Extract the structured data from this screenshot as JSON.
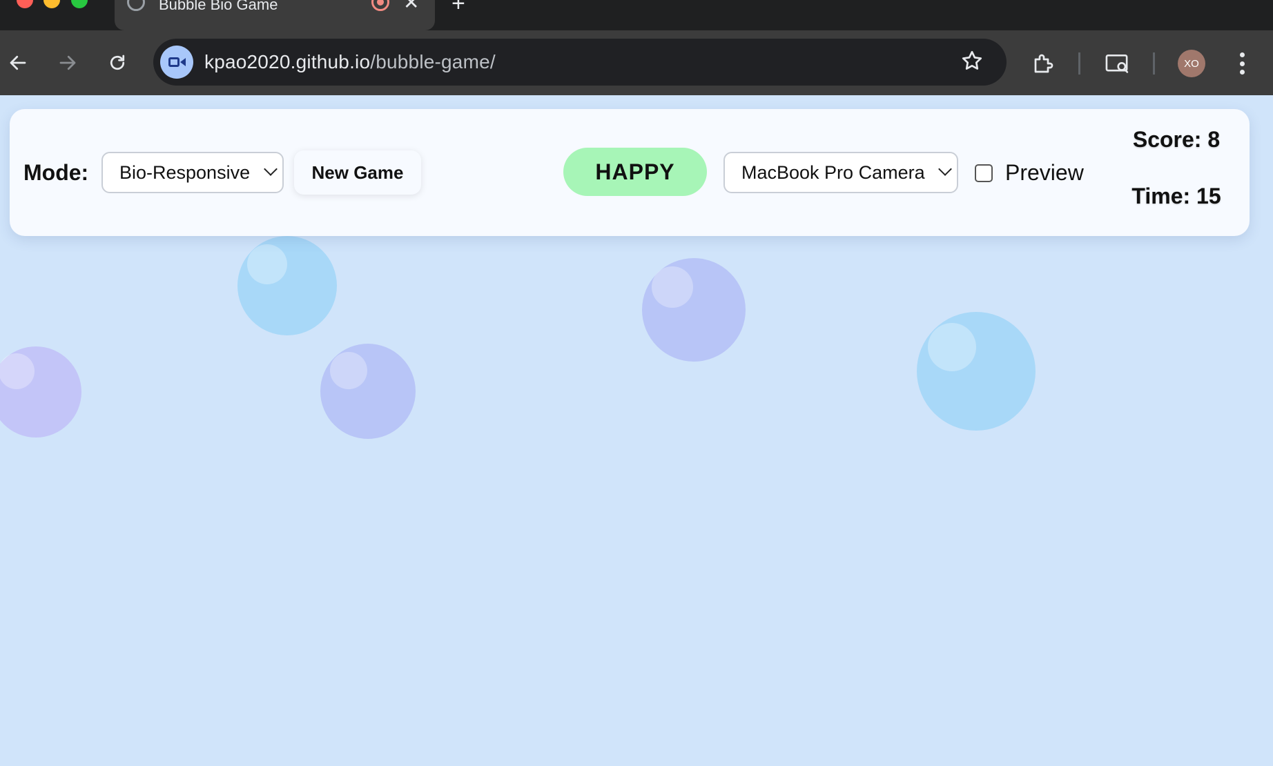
{
  "browser": {
    "tab_title": "Bubble Bio Game",
    "url_host": "kpao2020.github.io",
    "url_path": "/bubble-game/",
    "new_tab_glyph": "+",
    "close_glyph": "✕",
    "avatar_initials": "XO",
    "icons": [
      "back-arrow-icon",
      "forward-arrow-icon",
      "reload-icon",
      "camera-site-icon",
      "bookmark-star-icon",
      "extensions-icon",
      "screen-search-icon",
      "kebab-menu-icon"
    ]
  },
  "game": {
    "mode_label": "Mode:",
    "mode_value": "Bio-Responsive",
    "new_game_label": "New Game",
    "mood_label": "HAPPY",
    "camera_value": "MacBook Pro Camera",
    "preview_label": "Preview",
    "preview_checked": false,
    "score_text": "Score: 8",
    "time_text": "Time: 15"
  },
  "colors": {
    "page_bg": "#d0e4fa",
    "mood_bg": "#a7f5b7",
    "bubble_lavender": "#b8c5f7",
    "bubble_blue": "#a8d8f8",
    "bubble_purple": "#c3c5f8"
  }
}
